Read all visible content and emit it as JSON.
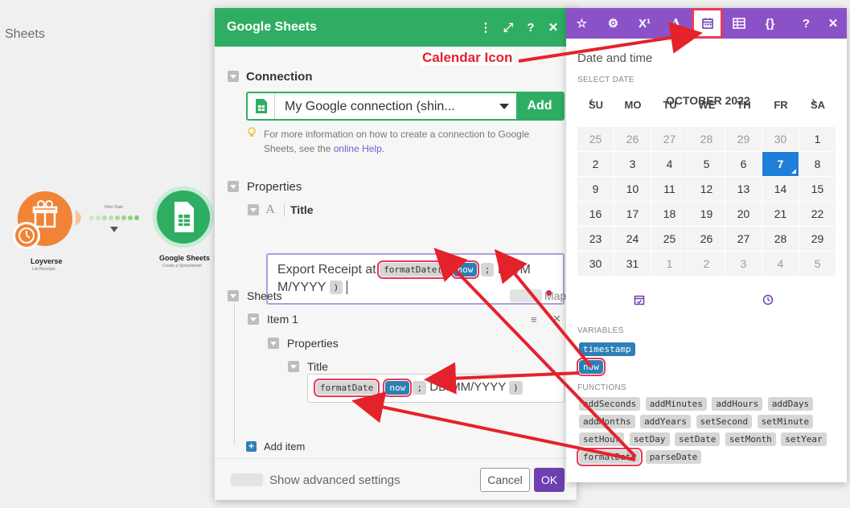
{
  "canvas": {
    "title": "Sheets"
  },
  "nodes": {
    "loyverse": {
      "name": "Loyverse",
      "sub": "List Receipts"
    },
    "gsheets": {
      "name": "Google Sheets",
      "sub": "Create a Spreadsheet"
    },
    "filter_label": "Filter Date"
  },
  "modal": {
    "title": "Google Sheets",
    "connection_label": "Connection",
    "connection_value": "My Google connection (shin...",
    "add_label": "Add",
    "hint_text": "For more information on how to create a connection to Google Sheets, see the ",
    "hint_link": "online Help",
    "hint_end": ".",
    "properties_label": "Properties",
    "title_label": "Title",
    "title_prefix": "Export Receipt at",
    "fn_formatdate": "formatDate(",
    "var_now": "now",
    "sep": ";",
    "fmt_text1": "DD/M",
    "fmt_text2": "M/YYYY",
    "close_paren": ")",
    "sheets_label": "Sheets",
    "map_label": "Map",
    "item_label": "Item 1",
    "nested_properties_label": "Properties",
    "nested_title_label": "Title",
    "nested_fn": "formatDate",
    "nested_var": "now",
    "nested_fmt": "DD/MM/YYYY",
    "add_item_label": "Add item",
    "advanced_label": "Show advanced settings",
    "cancel_label": "Cancel",
    "ok_label": "OK"
  },
  "date_panel": {
    "heading": "Date and time",
    "select_date_label": "SELECT DATE",
    "month_label": "OCTOBER 2022",
    "weekdays": [
      "SU",
      "MO",
      "TU",
      "WE",
      "TH",
      "FR",
      "SA"
    ],
    "weeks": [
      [
        "25",
        "26",
        "27",
        "28",
        "29",
        "30",
        "1"
      ],
      [
        "2",
        "3",
        "4",
        "5",
        "6",
        "7",
        "8"
      ],
      [
        "9",
        "10",
        "11",
        "12",
        "13",
        "14",
        "15"
      ],
      [
        "16",
        "17",
        "18",
        "19",
        "20",
        "21",
        "22"
      ],
      [
        "23",
        "24",
        "25",
        "26",
        "27",
        "28",
        "29"
      ],
      [
        "30",
        "31",
        "1",
        "2",
        "3",
        "4",
        "5"
      ]
    ],
    "selected_day": "7",
    "variables_label": "VARIABLES",
    "variables": [
      "timestamp",
      "now"
    ],
    "functions_label": "FUNCTIONS",
    "functions": [
      "addSeconds",
      "addMinutes",
      "addHours",
      "addDays",
      "addMonths",
      "addYears",
      "setSecond",
      "setMinute",
      "setHour",
      "setDay",
      "setDate",
      "setMonth",
      "setYear",
      "formatDate",
      "parseDate"
    ]
  },
  "annotation": {
    "label": "Calendar Icon"
  },
  "colors": {
    "accent_green": "#2fae63",
    "purple": "#8b52c8",
    "highlight": "#e8395a",
    "variable_blue": "#2d7fb4",
    "today_blue": "#1e7ed8",
    "arrow_red": "#e4222b"
  }
}
